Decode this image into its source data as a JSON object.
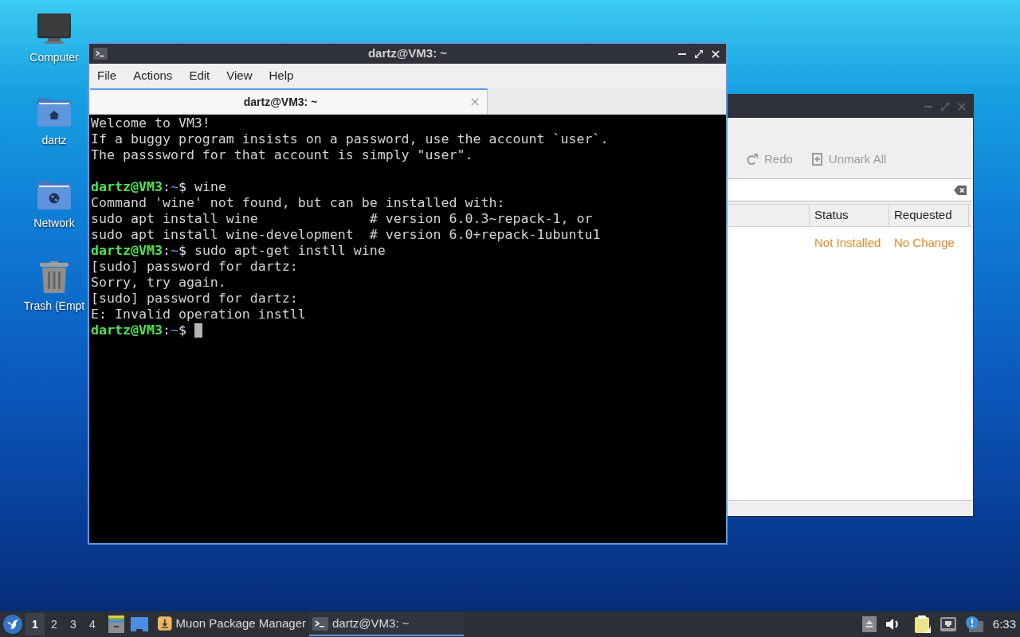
{
  "desktop_icons": [
    {
      "label": "Computer",
      "kind": "computer"
    },
    {
      "label": "dartz",
      "kind": "home"
    },
    {
      "label": "Network",
      "kind": "network"
    },
    {
      "label": "Trash (Empt",
      "kind": "trash"
    }
  ],
  "package_window": {
    "active": false,
    "toolbar": [
      {
        "kind": "redo",
        "label": "Redo",
        "disabled": true
      },
      {
        "kind": "unmark",
        "label": "Unmark All",
        "disabled": true
      }
    ],
    "table": {
      "columns": [
        "Status",
        "Requested"
      ],
      "rows": [
        {
          "status": "Not Installed",
          "requested": "No Change"
        }
      ]
    }
  },
  "terminal_window": {
    "active": true,
    "title": "dartz@VM3: ~",
    "menu": [
      "File",
      "Actions",
      "Edit",
      "View",
      "Help"
    ],
    "tabs": [
      {
        "label": "dartz@VM3: ~",
        "selected": true
      }
    ],
    "lines": [
      {
        "kind": "output",
        "text": "Welcome to VM3!"
      },
      {
        "kind": "output",
        "text": "If a buggy program insists on a password, use the account `user`."
      },
      {
        "kind": "output",
        "text": "The passsword for that account is simply \"user\"."
      },
      {
        "kind": "blank"
      },
      {
        "kind": "prompt",
        "user": "dartz@VM3",
        "separator": ":",
        "path": "~",
        "symbol": "$",
        "command": "wine",
        "cursor": false
      },
      {
        "kind": "output",
        "text": "Command 'wine' not found, but can be installed with:"
      },
      {
        "kind": "output",
        "text": "sudo apt install wine              # version 6.0.3~repack-1, or"
      },
      {
        "kind": "output",
        "text": "sudo apt install wine-development  # version 6.0+repack-1ubuntu1"
      },
      {
        "kind": "prompt",
        "user": "dartz@VM3",
        "separator": ":",
        "path": "~",
        "symbol": "$",
        "command": "sudo apt-get instll wine",
        "cursor": false
      },
      {
        "kind": "output",
        "text": "[sudo] password for dartz:"
      },
      {
        "kind": "output",
        "text": "Sorry, try again."
      },
      {
        "kind": "output",
        "text": "[sudo] password for dartz:"
      },
      {
        "kind": "output",
        "text": "E: Invalid operation instll"
      },
      {
        "kind": "prompt",
        "user": "dartz@VM3",
        "separator": ":",
        "path": "~",
        "symbol": "$",
        "cursor": true
      }
    ]
  },
  "taskbar": {
    "workspaces": [
      {
        "label": "1",
        "selected": true
      },
      {
        "label": "2",
        "selected": false
      },
      {
        "label": "3",
        "selected": false
      },
      {
        "label": "4",
        "selected": false
      }
    ],
    "tasks": [
      {
        "kind": "package",
        "label": "Muon Package Manager",
        "selected": false
      },
      {
        "kind": "terminal",
        "label": "dartz@VM3: ~",
        "selected": true
      }
    ],
    "clock": "6:33"
  }
}
